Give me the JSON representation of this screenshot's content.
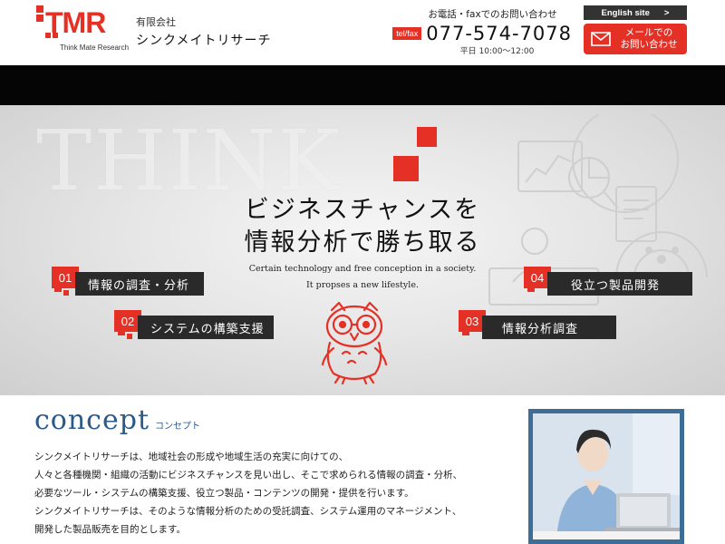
{
  "header": {
    "logo_text": "TMR",
    "logo_sub": "Think Mate Research",
    "company_type": "有限会社",
    "company_name": "シンクメイトリサーチ",
    "contact_label": "お電話・faxでのお問い合わせ",
    "telfax_tag": "tel/fax",
    "phone": "077-574-7078",
    "hours": "平日 10:00〜12:00",
    "english_label": "English site",
    "english_arrow": ">",
    "mail_line1": "メールでの",
    "mail_line2": "お問い合わせ"
  },
  "hero": {
    "watermark": "THINK",
    "title_line1": "ビジネスチャンスを",
    "title_line2": "情報分析で勝ち取る",
    "tagline_line1": "Certain technology and free conception in a society.",
    "tagline_line2": "It propses a new lifestyle.",
    "features": [
      {
        "num": "01",
        "label": "情報の調査・分析"
      },
      {
        "num": "02",
        "label": "システムの構築支援"
      },
      {
        "num": "03",
        "label": "情報分析調査"
      },
      {
        "num": "04",
        "label": "役立つ製品開発"
      }
    ]
  },
  "concept": {
    "title_en": "concept",
    "title_ja": "コンセプト",
    "lines": [
      "シンクメイトリサーチは、地域社会の形成や地域生活の充実に向けての、",
      "人々と各種機関・組織の活動にビジネスチャンスを見い出し、そこで求められる情報の調査・分析、",
      "必要なツール・システムの構築支援、役立つ製品・コンテンツの開発・提供を行います。",
      "シンクメイトリサーチは、そのような情報分析のための受託調査、システム運用のマネージメント、",
      "開発した製品販売を目的とします。"
    ]
  },
  "colors": {
    "accent": "#e53026",
    "dark": "#2a2a2a",
    "concept_blue": "#2b5a8a"
  },
  "icons": [
    "mail-icon",
    "owl-mascot-icon",
    "chart-deco-icon"
  ]
}
